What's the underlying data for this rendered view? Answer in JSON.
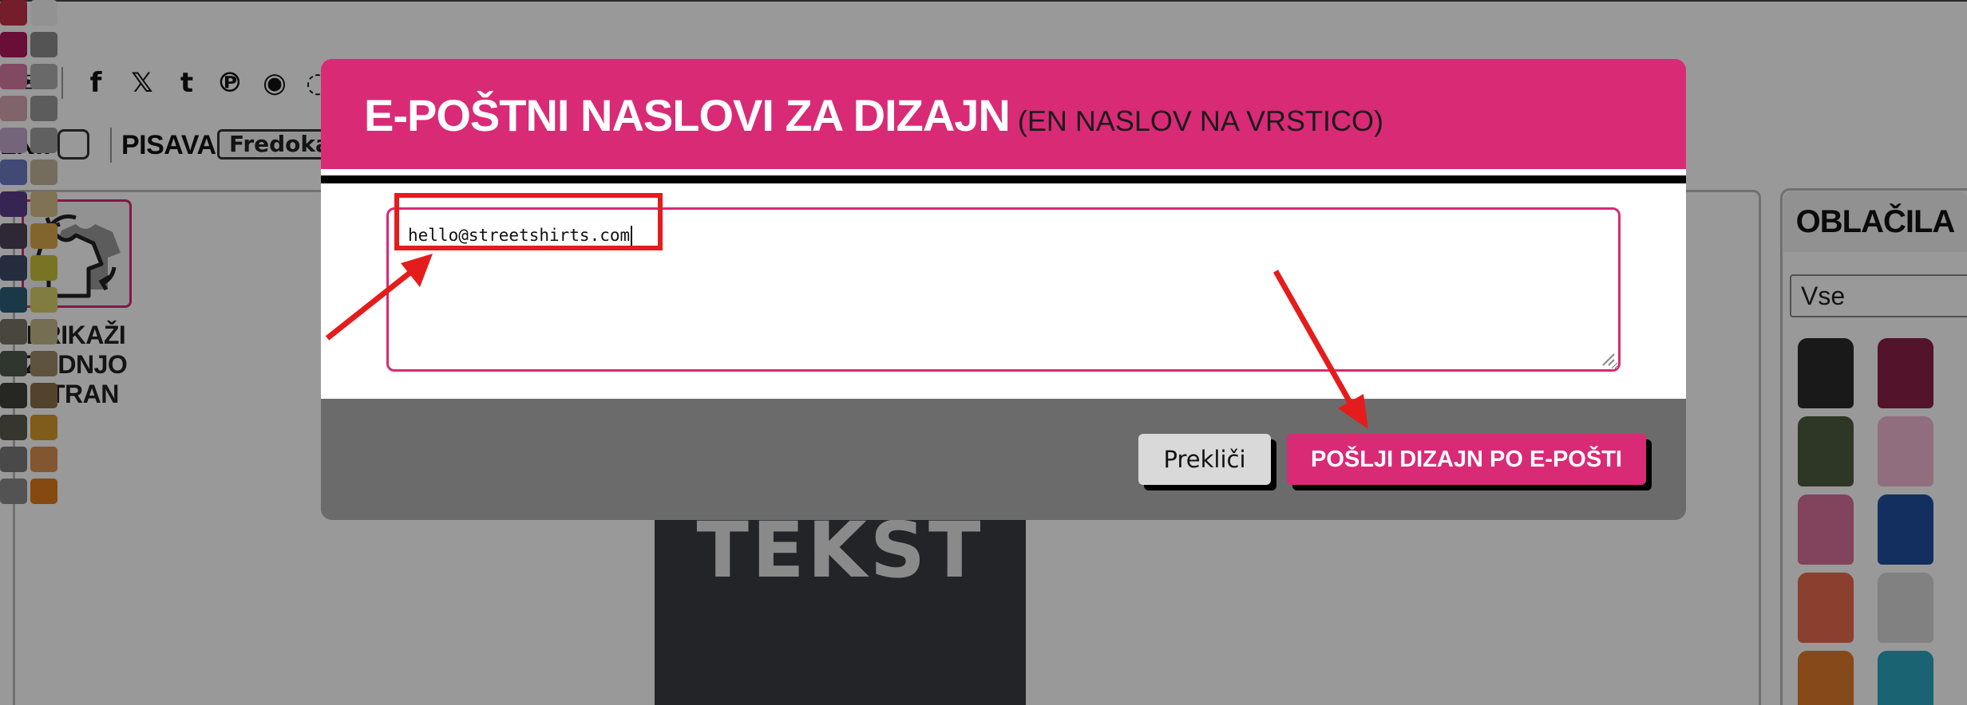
{
  "share": {
    "icons": [
      "mail-icon",
      "facebook-icon",
      "x-icon",
      "tumblr-icon",
      "pinterest-icon",
      "reddit-icon",
      "whatsapp-icon"
    ],
    "glyphs": [
      "✉",
      "f",
      "𝕏",
      "t",
      "℗",
      "◉",
      "◌"
    ]
  },
  "options": {
    "cut_label": "LNI:",
    "font_label": "PISAVA:",
    "font_value": "Fredoka"
  },
  "canvas": {
    "back_label_lines": [
      "PRIKAŽI",
      "ZADNJO",
      "STRAN"
    ],
    "shirt_text": "TEKST"
  },
  "side_panel": {
    "tab": "OBLAČILA",
    "filter": "Vse"
  },
  "modal": {
    "title": "E-POŠTNI NASLOVI ZA DIZAJN",
    "subtitle": "(EN NASLOV NA VRSTICO)",
    "email_value": "hello@streetshirts.com",
    "cancel_label": "Prekliči",
    "send_label": "POŠLJI DIZAJN PO E-POŠTI"
  },
  "colors": {
    "accent": "#d92a76",
    "annotation": "#e51c1c",
    "footer": "#6b6b6b",
    "swatches_left": [
      "#c2334a",
      "#b0185a",
      "#d97aa6",
      "#d8a6b4",
      "#c4a8cc",
      "#6d7bc4",
      "#5a3f8a",
      "#4b4457",
      "#3f4a68",
      "#2d5e7a",
      "#7a7566",
      "#4d5a4e",
      "#40403a",
      "#5b5b4e",
      "#7a7a7a",
      "#8b8b8b"
    ],
    "swatches_right": [
      "#f4f4f4",
      "#8d8d8d",
      "#b0b0b0",
      "#9a9a9a",
      "#a2a0a0",
      "#c2b69c",
      "#d4c08a",
      "#d9a84a",
      "#c9c23c",
      "#d8cf6a",
      "#c4b88a",
      "#9c8a6a",
      "#8a6e4a",
      "#d49a2a",
      "#d89050",
      "#e07a1a"
    ],
    "garments": [
      "#2b2b2b",
      "#8a2148",
      "#4e5a3e",
      "#f0b8d0",
      "#d9709a",
      "#1f4fa0",
      "#e86a4e",
      "#d8d8d8",
      "#e07a2a",
      "#2ba6c0"
    ]
  }
}
